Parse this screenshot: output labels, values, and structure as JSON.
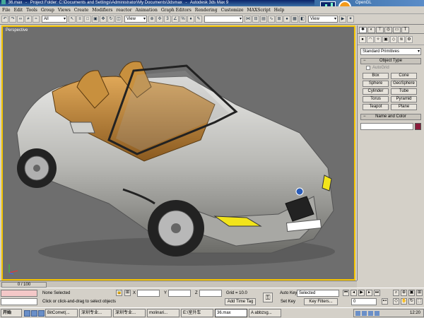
{
  "titlebar": {
    "filename": "36.max",
    "project": "Project Folder: C:\\Documents and Settings\\Administrator\\My Documents\\3dsmax",
    "app": "Autodesk 3ds Max 9",
    "renderer": "OpenGL"
  },
  "menu": [
    "File",
    "Edit",
    "Tools",
    "Group",
    "Views",
    "Create",
    "Modifiers",
    "reactor",
    "Animation",
    "Graph Editors",
    "Rendering",
    "Customize",
    "MAXScript",
    "Help"
  ],
  "toolbar": {
    "selection_filter": "All",
    "ref_coord": "View",
    "named_set": "",
    "right_view": "View"
  },
  "viewport": {
    "label": "Perspective",
    "accent_color": "#f5c400"
  },
  "command_panel": {
    "primitive_type": "Standard Primitives",
    "object_type_header": "Object Type",
    "autogrid": "AutoGrid",
    "primitives": [
      "Box",
      "Cone",
      "Sphere",
      "GeoSphere",
      "Cylinder",
      "Tube",
      "Torus",
      "Pyramid",
      "Teapot",
      "Plane"
    ],
    "name_color_header": "Name and Color",
    "object_color": "#8b1a3a"
  },
  "timeline": {
    "frame": "0 / 100"
  },
  "status": {
    "selection": "None Selected",
    "prompt": "Click or click-and-drag to select objects",
    "x_label": "X",
    "y_label": "Y",
    "z_label": "Z",
    "grid": "Grid = 10.0",
    "add_time_tag": "Add Time Tag",
    "auto_key": "Auto Key",
    "set_key": "Set Key",
    "selected": "Selected",
    "key_filters": "Key Filters...",
    "frame_value": "0"
  },
  "taskbar": {
    "start": "开始",
    "tasks": [
      "BitComet(...",
      "深圳专业...",
      "深圳专业...",
      "molinari...",
      "E:\\室外车",
      "36.max",
      "A abbzsg..."
    ],
    "clock": "12:20"
  }
}
